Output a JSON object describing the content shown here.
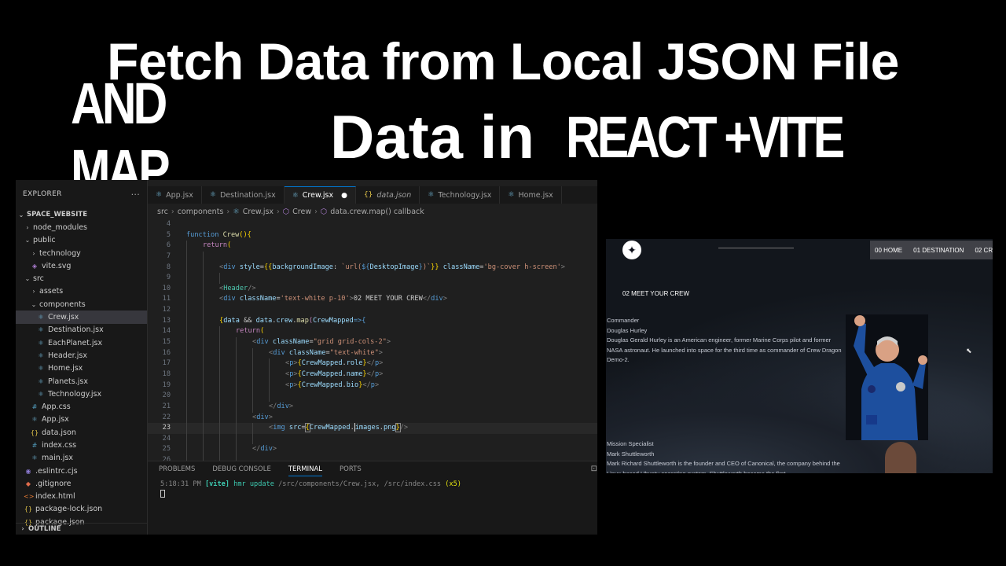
{
  "headline": {
    "line1": "Fetch Data from Local JSON File",
    "line2a": "AND MAP",
    "line2b": "Data in",
    "line2c": "REACT +VITE"
  },
  "explorer": {
    "header": "EXPLORER",
    "more": "···",
    "project": "SPACE_WEBSITE",
    "items": [
      {
        "label": "node_modules"
      },
      {
        "label": "public"
      },
      {
        "label": "technology"
      },
      {
        "label": "vite.svg"
      },
      {
        "label": "src"
      },
      {
        "label": "assets"
      },
      {
        "label": "components"
      },
      {
        "label": "Crew.jsx"
      },
      {
        "label": "Destination.jsx"
      },
      {
        "label": "EachPlanet.jsx"
      },
      {
        "label": "Header.jsx"
      },
      {
        "label": "Home.jsx"
      },
      {
        "label": "Planets.jsx"
      },
      {
        "label": "Technology.jsx"
      },
      {
        "label": "App.css"
      },
      {
        "label": "App.jsx"
      },
      {
        "label": "data.json"
      },
      {
        "label": "index.css"
      },
      {
        "label": "main.jsx"
      },
      {
        "label": ".eslintrc.cjs"
      },
      {
        "label": ".gitignore"
      },
      {
        "label": "index.html"
      },
      {
        "label": "package-lock.json"
      },
      {
        "label": "package.json"
      }
    ],
    "outline": "OUTLINE"
  },
  "tabs": [
    {
      "label": "App.jsx"
    },
    {
      "label": "Destination.jsx"
    },
    {
      "label": "Crew.jsx"
    },
    {
      "label": "data.json"
    },
    {
      "label": "Technology.jsx"
    },
    {
      "label": "Home.jsx"
    }
  ],
  "breadcrumb": {
    "src": "src",
    "components": "components",
    "file": "Crew.jsx",
    "symbol": "Crew",
    "callback": "data.crew.map() callback"
  },
  "editor": {
    "line_numbers": [
      "4",
      "5",
      "6",
      "7",
      "8",
      "9",
      "10",
      "11",
      "12",
      "13",
      "14",
      "15",
      "16",
      "17",
      "18",
      "19",
      "20",
      "21",
      "22",
      "23",
      "24",
      "25",
      "26"
    ],
    "current_line": "23"
  },
  "panel": {
    "tabs": [
      "PROBLEMS",
      "DEBUG CONSOLE",
      "TERMINAL",
      "PORTS"
    ],
    "active_tab": "TERMINAL",
    "log_time": "5:18:31 PM",
    "log_tag": "[vite]",
    "log_msg": "hmr update",
    "log_paths": "/src/components/Crew.jsx, /src/index.css",
    "log_count": "(x5)"
  },
  "preview": {
    "nav": [
      "00 HOME",
      "01 DESTINATION",
      "02 CR"
    ],
    "heading": "02 MEET YOUR CREW",
    "crew": [
      {
        "role": "Commander",
        "name": "Douglas Hurley",
        "bio": "Douglas Gerald Hurley is an American engineer, former Marine Corps pilot and former NASA astronaut. He launched into space for the third time as commander of Crew Dragon Demo-2."
      },
      {
        "role": "Mission Specialist",
        "name": "Mark Shuttleworth",
        "bio": "Mark Richard Shuttleworth is the founder and CEO of Canonical, the company behind the Linux-based Ubuntu operating system. Shuttleworth became the first"
      }
    ]
  },
  "colors": {
    "editor_bg": "#1f1f1f",
    "sidebar_bg": "#181818",
    "accent": "#0078d4"
  }
}
